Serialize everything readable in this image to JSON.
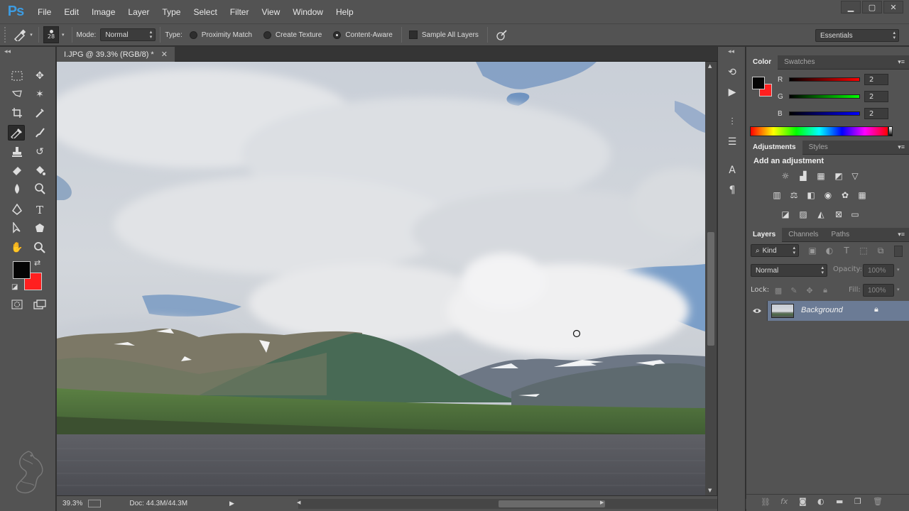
{
  "app": {
    "logo": "Ps"
  },
  "menu": [
    "File",
    "Edit",
    "Image",
    "Layer",
    "Type",
    "Select",
    "Filter",
    "View",
    "Window",
    "Help"
  ],
  "window_controls": [
    "minimize-icon",
    "maximize-icon",
    "close-icon"
  ],
  "options": {
    "brush_size": "28",
    "mode_label": "Mode:",
    "mode_value": "Normal",
    "type_label": "Type:",
    "type_options": [
      "Proximity Match",
      "Create Texture",
      "Content-Aware"
    ],
    "type_selected": "Content-Aware",
    "sample_all_layers": "Sample All Layers",
    "workspace": "Essentials"
  },
  "document": {
    "tab_title": "I.JPG @ 39.3% (RGB/8) *",
    "zoom": "39.3%",
    "doc_info": "Doc: 44.3M/44.3M"
  },
  "colors": {
    "foreground": "#050505",
    "background": "#ff1f1f"
  },
  "color_panel": {
    "tabs": [
      "Color",
      "Swatches"
    ],
    "r_label": "R",
    "r_value": "2",
    "g_label": "G",
    "g_value": "2",
    "b_label": "B",
    "b_value": "2"
  },
  "adjustments_panel": {
    "tabs": [
      "Adjustments",
      "Styles"
    ],
    "heading": "Add an adjustment"
  },
  "layers_panel": {
    "tabs": [
      "Layers",
      "Channels",
      "Paths"
    ],
    "filter_kind": "Kind",
    "blend_mode": "Normal",
    "opacity_label": "Opacity:",
    "opacity_value": "100%",
    "lock_label": "Lock:",
    "fill_label": "Fill:",
    "fill_value": "100%",
    "layers": [
      {
        "name": "Background",
        "visible": true,
        "locked": true
      }
    ]
  }
}
